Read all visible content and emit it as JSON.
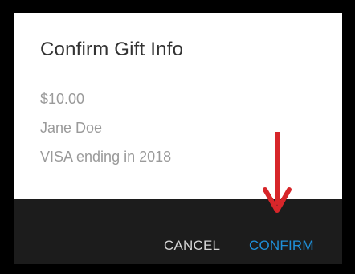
{
  "dialog": {
    "title": "Confirm Gift Info",
    "amount": "$10.00",
    "recipient": "Jane Doe",
    "payment": "VISA ending in 2018",
    "cancel_label": "CANCEL",
    "confirm_label": "CONFIRM"
  },
  "annotation": {
    "arrow_icon": "down-arrow-icon",
    "arrow_color": "#d7262a"
  },
  "colors": {
    "dialog_bg": "#ffffff",
    "footer_bg": "#1c1c1c",
    "title_text": "#333333",
    "info_text": "#9a9a9a",
    "cancel_text": "#d6d6d6",
    "confirm_text": "#1f8fd8",
    "outer_bg": "#000000"
  }
}
